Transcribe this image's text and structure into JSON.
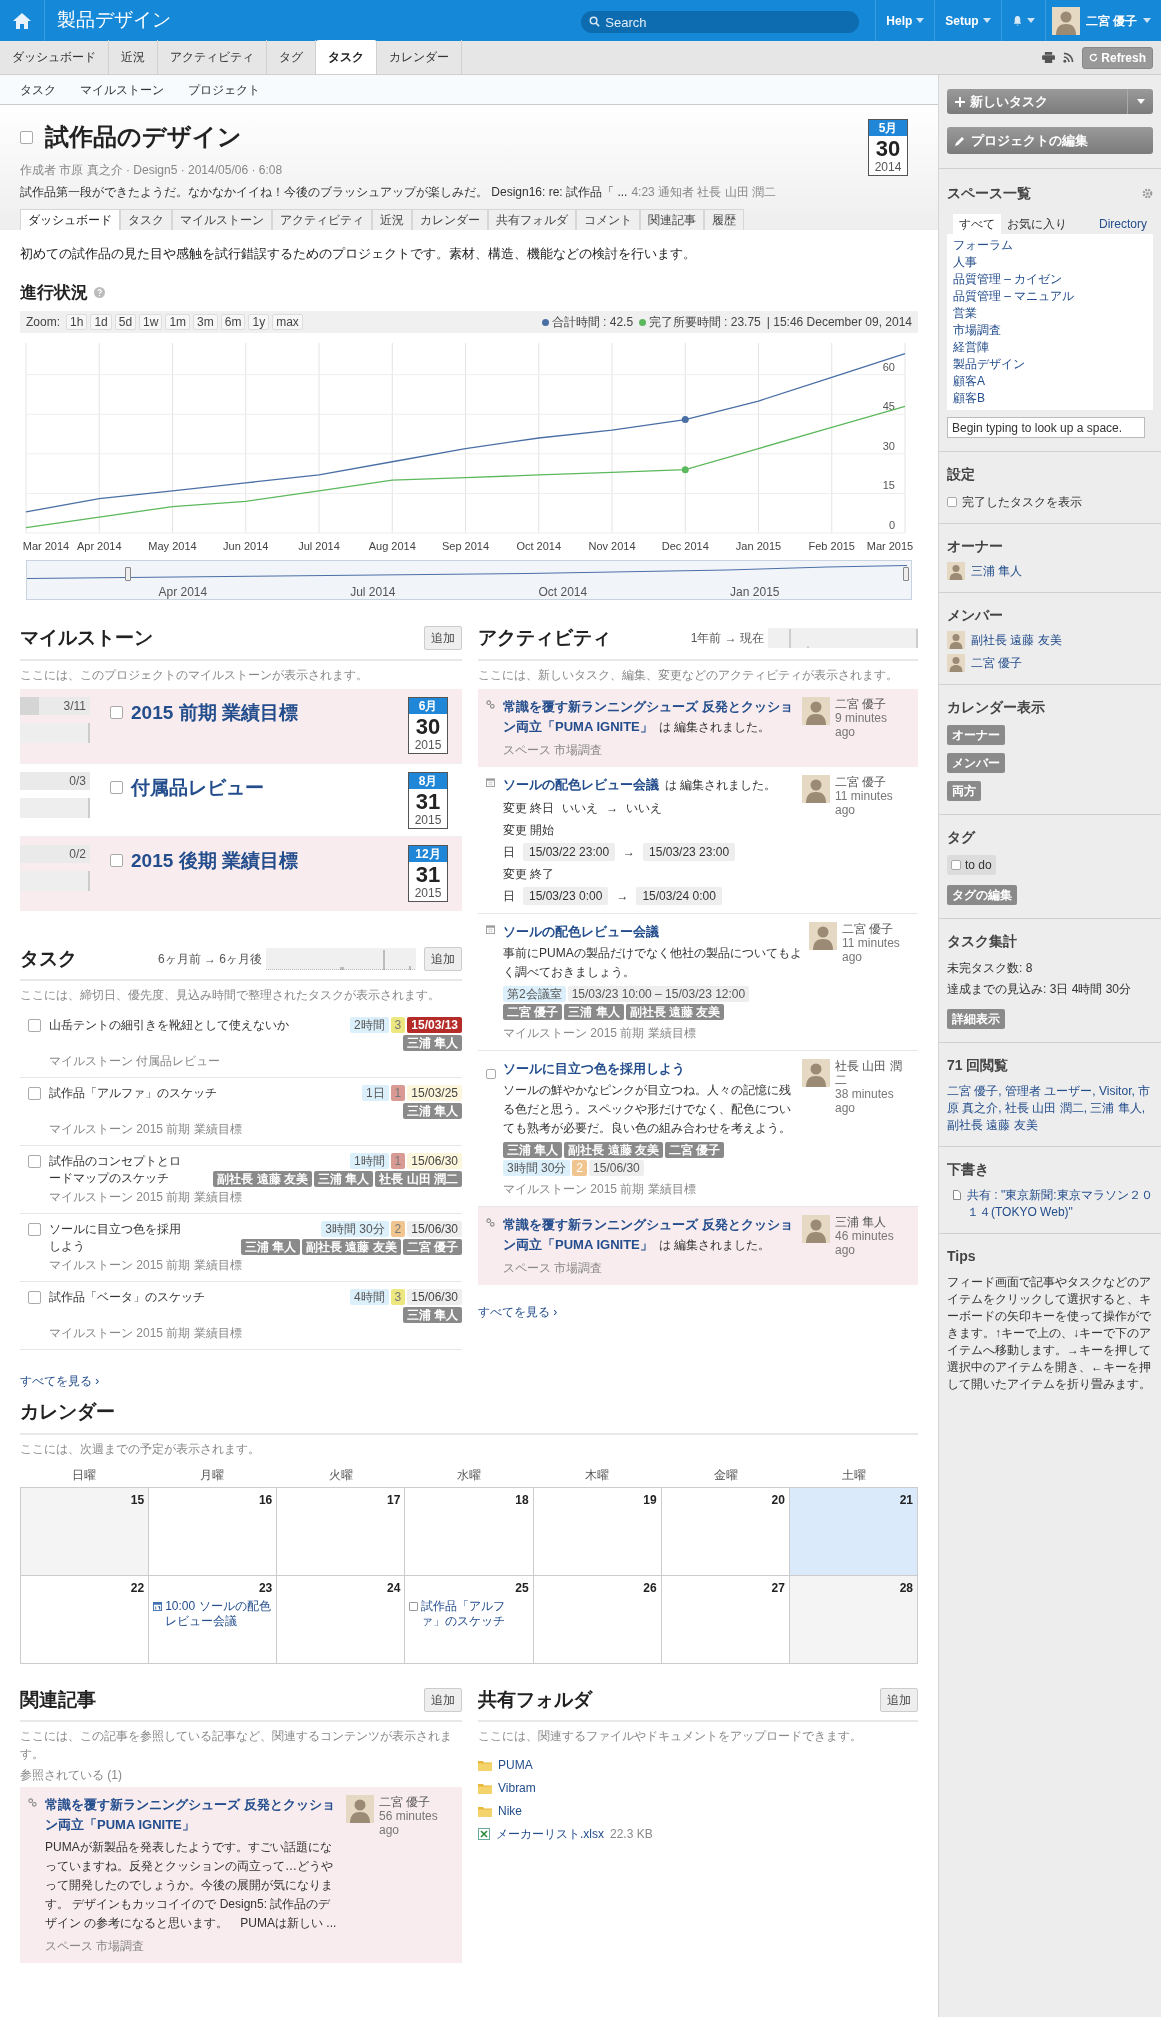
{
  "header": {
    "app_title": "製品デザイン",
    "search_placeholder": "Search",
    "menus": [
      "Help",
      "Setup"
    ],
    "user": "二宮 優子"
  },
  "nav_tabs": [
    {
      "label": "ダッシュボード",
      "selected": false
    },
    {
      "label": "近況",
      "selected": false
    },
    {
      "label": "アクティビティ",
      "selected": false
    },
    {
      "label": "タグ",
      "selected": false
    },
    {
      "label": "タスク",
      "selected": true
    },
    {
      "label": "カレンダー",
      "selected": false
    }
  ],
  "refresh": "Refresh",
  "subnav": [
    "タスク",
    "マイルストーン",
    "プロジェクト"
  ],
  "project": {
    "title": "試作品のデザイン",
    "checked": false,
    "meta": "作成者 市原 真之介 · Design5 · 2014/05/06 · 6:08",
    "latest_comment": "試作品第一段ができたようだ。なかなかイイね！今後のブラッシュアップが楽しみだ。 Design16: re: 試作品「 ...",
    "comment_meta": "4:23 通知者 社長 山田 潤二",
    "due": {
      "month": "5月",
      "day": "30",
      "year": "2014"
    }
  },
  "page_tabs": [
    {
      "label": "ダッシュボード",
      "selected": true
    },
    {
      "label": "タスク",
      "selected": false
    },
    {
      "label": "マイルストーン",
      "selected": false
    },
    {
      "label": "アクティビティ",
      "selected": false
    },
    {
      "label": "近況",
      "selected": false
    },
    {
      "label": "カレンダー",
      "selected": false
    },
    {
      "label": "共有フォルダ",
      "selected": false
    },
    {
      "label": "コメント",
      "selected": false
    },
    {
      "label": "関連記事",
      "selected": false
    },
    {
      "label": "履歴",
      "selected": false
    }
  ],
  "description": "初めての試作品の見た目や感触を試行錯誤するためのプロジェクトです。素材、構造、機能などの検討を行います。",
  "progress": {
    "title": "進行状況",
    "zoom_label": "Zoom:",
    "zoom_buttons": [
      "1h",
      "1d",
      "5d",
      "1w",
      "1m",
      "3m",
      "6m",
      "1y",
      "max"
    ],
    "legend_values": [
      ": 42.5",
      ": 23.75"
    ],
    "timestamp": "| 15:46 December 09, 2014",
    "chart_data": {
      "type": "line",
      "grid": true,
      "x": [
        "Mar 2014",
        "Apr 2014",
        "May 2014",
        "Jun 2014",
        "Jul 2014",
        "Aug 2014",
        "Sep 2014",
        "Oct 2014",
        "Nov 2014",
        "Dec 2014",
        "Jan 2015",
        "Feb 2015",
        "Mar 2015"
      ],
      "ylim": [
        0,
        72
      ],
      "yticks": [
        0,
        15,
        30,
        45,
        60
      ],
      "series": [
        {
          "name": "合計時間",
          "color": "#4a6fa5",
          "values": [
            8,
            13,
            16,
            19,
            22,
            27,
            32,
            36,
            39,
            43,
            50,
            59,
            68
          ]
        },
        {
          "name": "完了所要時間",
          "color": "#5cb85c",
          "values": [
            2,
            6,
            10,
            12,
            16,
            20,
            21,
            22,
            23,
            24,
            32,
            40,
            48
          ]
        }
      ]
    },
    "navigator_labels": [
      "Apr 2014",
      "Jul 2014",
      "Oct 2014",
      "Jan 2015"
    ]
  },
  "milestones": {
    "title": "マイルストーン",
    "add": "追加",
    "hint": "ここには、このプロジェクトのマイルストーンが表示されます。",
    "items": [
      {
        "progress": "3/11",
        "level": 0.27,
        "checked": false,
        "title": "2015 前期 業績目標",
        "highlighted": true,
        "due": {
          "month": "6月",
          "day": "30",
          "year": "2015"
        }
      },
      {
        "progress": "0/3",
        "level": 0,
        "checked": false,
        "title": "付属品レビュー",
        "highlighted": false,
        "due": {
          "month": "8月",
          "day": "31",
          "year": "2015"
        }
      },
      {
        "progress": "0/2",
        "level": 0,
        "checked": false,
        "title": "2015 後期 業績目標",
        "highlighted": true,
        "due": {
          "month": "12月",
          "day": "31",
          "year": "2015"
        }
      }
    ]
  },
  "tasks": {
    "title": "タスク",
    "range": "6ヶ月前 → 6ヶ月後",
    "add": "追加",
    "hint": "ここには、締切日、優先度、見込み時間で整理されたタスクが表示されます。",
    "see_all": "すべてを見る ›",
    "items": [
      {
        "checked": false,
        "title": "山岳テントの細引きを靴紐として使えないか",
        "milestone": "マイルストーン 付属品レビュー",
        "estimate": "2時間",
        "priority": {
          "label": "3",
          "color": "#ece77f"
        },
        "due": {
          "text": "15/03/13",
          "kind": "overdue"
        },
        "assignees": [
          "三浦 隼人"
        ]
      },
      {
        "checked": false,
        "title": "試作品「アルファ」のスケッチ",
        "milestone": "マイルストーン 2015 前期 業績目標",
        "estimate": "1日",
        "priority": {
          "label": "1",
          "color": "#d99a94"
        },
        "due": {
          "text": "15/03/25",
          "kind": "soon"
        },
        "assignees": [
          "三浦 隼人"
        ]
      },
      {
        "checked": false,
        "title": "試作品のコンセプトとロードマップのスケッチ",
        "milestone": "マイルストーン 2015 前期 業績目標",
        "estimate": "1時間",
        "priority": {
          "label": "1",
          "color": "#d99a94"
        },
        "due": {
          "text": "15/06/30",
          "kind": "soon"
        },
        "assignees": [
          "副社長 遠藤 友美",
          "三浦 隼人",
          "社長 山田 潤二"
        ]
      },
      {
        "checked": false,
        "title": "ソールに目立つ色を採用しよう",
        "milestone": "マイルストーン 2015 前期 業績目標",
        "estimate": "3時間 30分",
        "priority": {
          "label": "2",
          "color": "#f0c590"
        },
        "due": {
          "text": "15/06/30",
          "kind": "normal"
        },
        "assignees": [
          "三浦 隼人",
          "副社長 遠藤 友美",
          "二宮 優子"
        ]
      },
      {
        "checked": false,
        "title": "試作品「ベータ」のスケッチ",
        "milestone": "マイルストーン 2015 前期 業績目標",
        "estimate": "4時間",
        "priority": {
          "label": "3",
          "color": "#ece77f"
        },
        "due": {
          "text": "15/06/30",
          "kind": "normal"
        },
        "assignees": [
          "三浦 隼人"
        ]
      }
    ]
  },
  "activity": {
    "title": "アクティビティ",
    "range": "1年前 → 現在",
    "hint": "ここには、新しいタスク、編集、変更などのアクティビティが表示されます。",
    "see_all": "すべてを見る ›",
    "items": [
      {
        "kind": "link",
        "highlighted": true,
        "title": "常識を覆す新ランニングシューズ 反発とクッション両立「PUMA IGNITE」",
        "suffix": "は 編集されました。",
        "meta": "スペース 市場調査",
        "user": "二宮 優子",
        "time": "9 minutes ago"
      },
      {
        "kind": "event",
        "highlighted": false,
        "title": "ソールの配色レビュー会議",
        "suffix": "は 編集されました。",
        "changes": [
          {
            "label": "変更 終日",
            "from": "いいえ",
            "arrow": "→",
            "to": "いいえ",
            "boxed": false
          },
          {
            "label": "変更 開始"
          },
          {
            "label": "日",
            "from": "15/03/22 23:00",
            "arrow": "→",
            "to": "15/03/23 23:00",
            "boxed": true
          },
          {
            "label": "変更 終了"
          },
          {
            "label": "日",
            "from": "15/03/23 0:00",
            "arrow": "→",
            "to": "15/03/24 0:00",
            "boxed": true
          }
        ],
        "user": "二宮 優子",
        "time": "11 minutes ago"
      },
      {
        "kind": "event",
        "highlighted": false,
        "title": "ソールの配色レビュー会議",
        "body": "事前にPUMAの製品だけでなく他社の製品についてもよく調べておきましょう。",
        "tags": [
          {
            "text": "第2会議室",
            "kind": "place"
          },
          {
            "text": "15/03/23 10:00 – 15/03/23 12:00",
            "kind": "time"
          },
          {
            "text": "二宮 優子",
            "kind": "user"
          },
          {
            "text": "三浦 隼人",
            "kind": "user"
          },
          {
            "text": "副社長 遠藤 友美",
            "kind": "user"
          }
        ],
        "meta": "マイルストーン 2015 前期 業績目標",
        "user": "二宮 優子",
        "time": "11 minutes ago"
      },
      {
        "kind": "task",
        "highlighted": false,
        "checked": false,
        "title": "ソールに目立つ色を採用しよう",
        "body": "ソールの鮮やかなピンクが目立つね。人々の記憶に残る色だと思う。スペックや形だけでなく、配色についても熟考が必要だ。良い色の組み合わせを考えよう。",
        "tags": [
          {
            "text": "三浦 隼人",
            "kind": "user"
          },
          {
            "text": "副社長 遠藤 友美",
            "kind": "user"
          },
          {
            "text": "二宮 優子",
            "kind": "user"
          },
          {
            "text": "3時間 30分",
            "kind": "estimate"
          },
          {
            "text": "2",
            "kind": "priority",
            "color": "#f0c590"
          },
          {
            "text": "15/06/30",
            "kind": "date"
          }
        ],
        "meta": "マイルストーン 2015 前期 業績目標",
        "user": "社長 山田 潤二",
        "time": "38 minutes ago"
      },
      {
        "kind": "link",
        "highlighted": true,
        "title": "常識を覆す新ランニングシューズ 反発とクッション両立「PUMA IGNITE」",
        "suffix": "は 編集されました。",
        "meta": "スペース 市場調査",
        "user": "三浦 隼人",
        "time": "46 minutes ago"
      }
    ]
  },
  "calendar": {
    "title": "カレンダー",
    "hint": "ここには、次週までの予定が表示されます。",
    "weekdays": [
      "日曜",
      "月曜",
      "火曜",
      "水曜",
      "木曜",
      "金曜",
      "土曜"
    ],
    "weeks": [
      [
        {
          "day": "15",
          "kind": "gray"
        },
        {
          "day": "16",
          "kind": "plain"
        },
        {
          "day": "17",
          "kind": "plain"
        },
        {
          "day": "18",
          "kind": "plain"
        },
        {
          "day": "19",
          "kind": "plain"
        },
        {
          "day": "20",
          "kind": "plain"
        },
        {
          "day": "21",
          "kind": "today"
        }
      ],
      [
        {
          "day": "22",
          "kind": "plain"
        },
        {
          "day": "23",
          "kind": "plain",
          "events": [
            {
              "kind": "event",
              "text": "10:00 ソールの配色レビュー会議"
            }
          ]
        },
        {
          "day": "24",
          "kind": "plain"
        },
        {
          "day": "25",
          "kind": "plain",
          "events": [
            {
              "kind": "task",
              "text": "試作品「アルファ」のスケッチ"
            }
          ]
        },
        {
          "day": "26",
          "kind": "plain"
        },
        {
          "day": "27",
          "kind": "plain"
        },
        {
          "day": "28",
          "kind": "gray"
        }
      ]
    ]
  },
  "related": {
    "title": "関連記事",
    "add": "追加",
    "hint": "ここには、この記事を参照している記事など、関連するコンテンツが表示されます。",
    "ref_label": "参照されている (1)",
    "items": [
      {
        "title": "常識を覆す新ランニングシューズ 反発とクッション両立「PUMA IGNITE」",
        "body": "PUMAが新製品を発表したようです。すごい話題になっていますね。反発とクッションの両立って…どうやって開発したのでしょうか。今後の展開が気になります。 デザインもカッコイイので Design5: 試作品のデザイン の参考になると思います。　PUMAは新しい ...",
        "meta": "スペース 市場調査",
        "user": "二宮 優子",
        "time": "56 minutes ago"
      }
    ]
  },
  "shared": {
    "title": "共有フォルダ",
    "add": "追加",
    "hint": "ここには、関連するファイルやドキュメントをアップロードできます。",
    "items": [
      {
        "kind": "folder",
        "name": "PUMA"
      },
      {
        "kind": "folder",
        "name": "Vibram"
      },
      {
        "kind": "folder",
        "name": "Nike"
      },
      {
        "kind": "file",
        "name": "メーカーリスト.xlsx",
        "size": "22.3 KB"
      }
    ]
  },
  "sidebar": {
    "new_task": "新しいタスク",
    "edit_project": "プロジェクトの編集",
    "spaces": {
      "title": "スペース一覧",
      "tabs": [
        {
          "label": "すべて",
          "selected": true
        },
        {
          "label": "お気に入り",
          "selected": false
        },
        {
          "label": "Directory",
          "selected": false
        }
      ],
      "items": [
        "フォーラム",
        "人事",
        "品質管理 – カイゼン",
        "品質管理 – マニュアル",
        "営業",
        "市場調査",
        "経営陣",
        "製品デザイン",
        "顧客A",
        "顧客B"
      ],
      "lookup_placeholder": "Begin typing to look up a space."
    },
    "settings": {
      "title": "設定",
      "options": [
        {
          "label": "完了したタスクを表示",
          "checked": false
        }
      ]
    },
    "owner": {
      "title": "オーナー",
      "users": [
        "三浦 隼人"
      ]
    },
    "members": {
      "title": "メンバー",
      "users": [
        "副社長 遠藤 友美",
        "二宮 優子"
      ]
    },
    "calendar_view": {
      "title": "カレンダー表示",
      "buttons": [
        "オーナー",
        "メンバー",
        "両方"
      ]
    },
    "tags": {
      "title": "タグ",
      "items": [
        {
          "label": "to do",
          "checked": false
        }
      ],
      "edit": "タグの編集"
    },
    "task_summary": {
      "title": "タスク集計",
      "lines": [
        "未完タスク数: 8",
        "達成までの見込み: 3日 4時間 30分"
      ],
      "button": "詳細表示"
    },
    "views": {
      "title": "71 回閲覧",
      "text": "二宮 優子, 管理者 ユーザー, Visitor, 市原 真之介, 社長 山田 潤二, 三浦 隼人, 副社長 遠藤 友美"
    },
    "drafts": {
      "title": "下書き",
      "items": [
        "共有 : \"東京新聞:東京マラソン２０１４(TOKYO Web)\""
      ]
    },
    "tips": {
      "title": "Tips",
      "text": "フィード画面で記事やタスクなどのアイテムをクリックして選択すると、キーボードの矢印キーを使って操作ができます。↑キーで上の、↓キーで下のアイテムへ移動します。→キーを押して選択中のアイテムを開き、←キーを押して開いたアイテムを折り畳みます。"
    }
  }
}
